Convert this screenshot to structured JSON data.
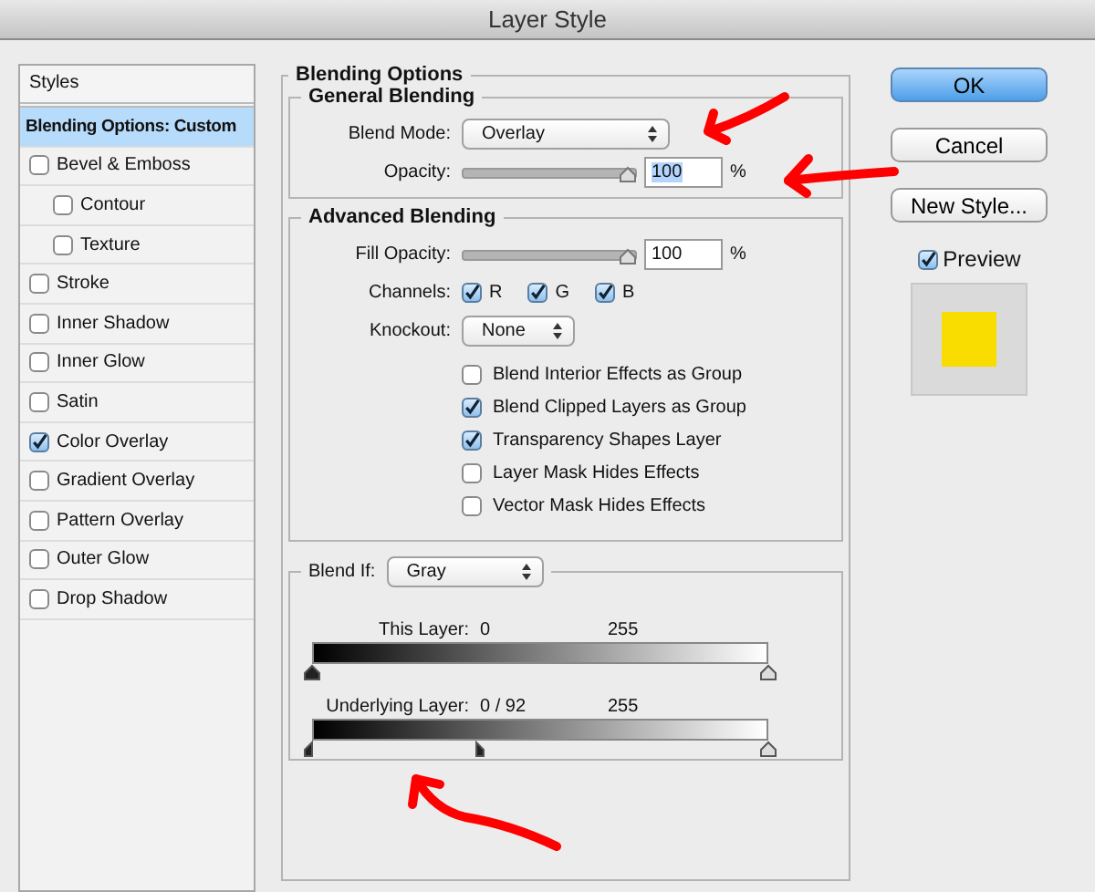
{
  "window": {
    "title": "Layer Style"
  },
  "styles_panel": {
    "header": "Styles",
    "items": [
      {
        "label": "Blending Options: Custom",
        "kind": "plain",
        "selected": true
      },
      {
        "label": "Bevel & Emboss",
        "kind": "check",
        "checked": false,
        "selected": false,
        "children": [
          {
            "label": "Contour",
            "kind": "check",
            "checked": false,
            "selected": false
          },
          {
            "label": "Texture",
            "kind": "check",
            "checked": false,
            "selected": false
          }
        ]
      },
      {
        "label": "Stroke",
        "kind": "check",
        "checked": false,
        "selected": false
      },
      {
        "label": "Inner Shadow",
        "kind": "check",
        "checked": false,
        "selected": false
      },
      {
        "label": "Inner Glow",
        "kind": "check",
        "checked": false,
        "selected": false
      },
      {
        "label": "Satin",
        "kind": "check",
        "checked": false,
        "selected": false
      },
      {
        "label": "Color Overlay",
        "kind": "check",
        "checked": true,
        "selected": false
      },
      {
        "label": "Gradient Overlay",
        "kind": "check",
        "checked": false,
        "selected": false
      },
      {
        "label": "Pattern Overlay",
        "kind": "check",
        "checked": false,
        "selected": false
      },
      {
        "label": "Outer Glow",
        "kind": "check",
        "checked": false,
        "selected": false
      },
      {
        "label": "Drop Shadow",
        "kind": "check",
        "checked": false,
        "selected": false
      }
    ]
  },
  "blending_options": {
    "title": "Blending Options",
    "general": {
      "title": "General Blending",
      "blend_mode": {
        "label": "Blend Mode:",
        "value": "Overlay"
      },
      "opacity": {
        "label": "Opacity:",
        "level": 1,
        "value": "100",
        "value_selected": true,
        "unit": "%"
      }
    },
    "advanced": {
      "title": "Advanced Blending",
      "fill_opacity": {
        "label": "Fill Opacity:",
        "level": 1,
        "value": "100",
        "value_selected": false,
        "unit": "%"
      },
      "channels": {
        "label": "Channels:",
        "items": [
          {
            "label": "R",
            "checked": true
          },
          {
            "label": "G",
            "checked": true
          },
          {
            "label": "B",
            "checked": true
          }
        ]
      },
      "knockout": {
        "label": "Knockout:",
        "value": "None"
      },
      "options": [
        {
          "label": "Blend Interior Effects as Group",
          "checked": false
        },
        {
          "label": "Blend Clipped Layers as Group",
          "checked": true
        },
        {
          "label": "Transparency Shapes Layer",
          "checked": true
        },
        {
          "label": "Layer Mask Hides Effects",
          "checked": false
        },
        {
          "label": "Vector Mask Hides Effects",
          "checked": false
        }
      ]
    },
    "blend_if": {
      "label": "Blend If:",
      "value": "Gray",
      "layers": [
        {
          "label": "This Layer:",
          "readings": [
            "0",
            "255"
          ],
          "thumbs": [
            {
              "kind": "whole",
              "color": "#222222",
              "level": 0
            },
            {
              "kind": "whole",
              "color": "#dddddd",
              "level": 1
            }
          ]
        },
        {
          "label": "Underlying Layer:",
          "readings": [
            "0  /  92",
            "255"
          ],
          "thumbs": [
            {
              "kind": "left-half",
              "color": "#222222",
              "level": 0
            },
            {
              "kind": "right-half",
              "color": "#222222",
              "level": 0.36
            },
            {
              "kind": "whole",
              "color": "#dddddd",
              "level": 1
            }
          ]
        }
      ]
    }
  },
  "buttons": [
    {
      "label": "OK",
      "default": true
    },
    {
      "label": "Cancel",
      "default": false
    },
    {
      "label": "New Style...",
      "default": false
    }
  ],
  "preview": {
    "label": "Preview",
    "checked": true
  }
}
